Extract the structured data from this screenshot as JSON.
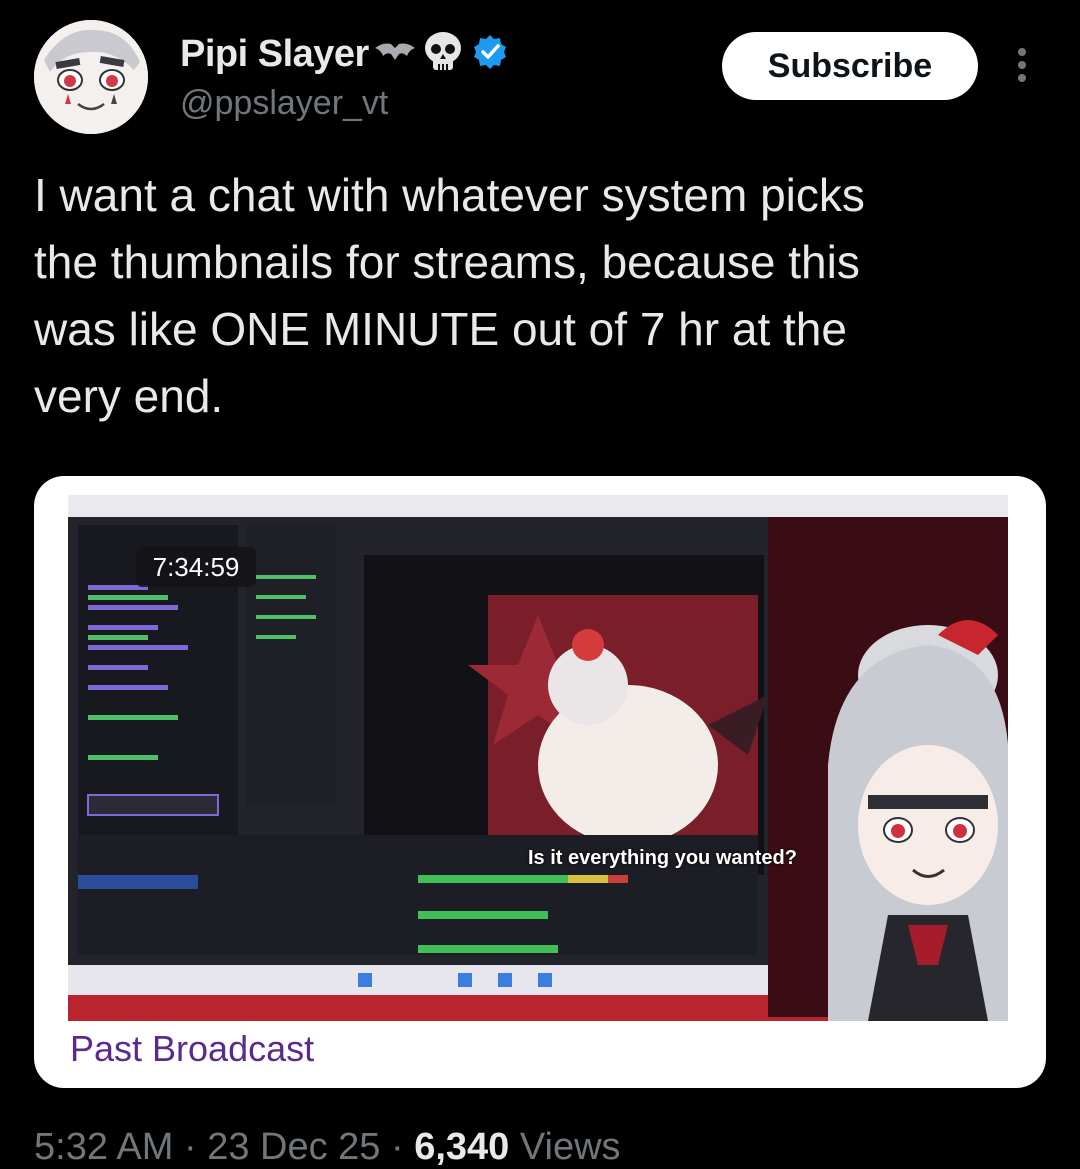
{
  "author": {
    "display_name": "Pipi Slayer",
    "handle": "@ppslayer_vt",
    "badges": [
      "bat-icon",
      "skull-icon",
      "verified-icon"
    ]
  },
  "actions": {
    "subscribe_label": "Subscribe",
    "more_icon": "more-vertical-icon"
  },
  "post": {
    "text": "I want a chat with whatever system picks\nthe thumbnails for streams, because this\nwas like ONE MINUTE out of 7 hr at the\nvery end."
  },
  "media_card": {
    "timestamp": "7:34:59",
    "subtitle": "Is it everything you wanted?",
    "label": "Past Broadcast"
  },
  "meta": {
    "time": "5:32 AM",
    "date": "23 Dec 25",
    "views_count": "6,340",
    "views_label": "Views"
  },
  "colors": {
    "background": "#000000",
    "text": "#e7e9ea",
    "secondary": "#71767b",
    "verified": "#1d9bf0",
    "card_label": "#5b2a8e"
  }
}
